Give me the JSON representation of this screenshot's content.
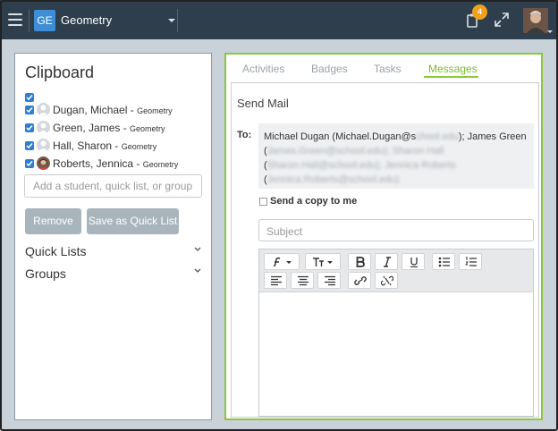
{
  "header": {
    "course_badge": "GE",
    "course_name": "Geometry",
    "notification_count": "4"
  },
  "clipboard": {
    "title": "Clipboard",
    "students": [
      {
        "name": "Dugan, Michael",
        "course": "Geometry"
      },
      {
        "name": "Green, James",
        "course": "Geometry"
      },
      {
        "name": "Hall, Sharon",
        "course": "Geometry"
      },
      {
        "name": "Roberts, Jennica",
        "course": "Geometry"
      }
    ],
    "separator": " - ",
    "add_placeholder": "Add a student, quick list, or group",
    "remove_label": "Remove",
    "save_label": "Save as Quick List",
    "quick_lists_label": "Quick Lists",
    "groups_label": "Groups"
  },
  "tabs": {
    "activities": "Activities",
    "badges": "Badges",
    "tasks": "Tasks",
    "messages": "Messages"
  },
  "mail": {
    "title": "Send Mail",
    "to_label": "To:",
    "to_line1_a": "Michael Dugan (Michael.Dugan@s",
    "to_line1_blur": "chool.edu",
    "to_line1_b": "); James Green",
    "to_line2_a": "(",
    "to_line2_blur": "James.Green@school.edu); Sharon Hall",
    "to_line3_a": "(",
    "to_line3_blur": "Sharon.Hall@school.edu); Jennica Roberts",
    "to_line4_a": "(",
    "to_line4_blur": "Jennica.Roberts@school.edu)",
    "copy_label": "Send a copy to me",
    "subject_placeholder": "Subject"
  },
  "colors": {
    "topbar": "#2f3e4c",
    "accent_green": "#8cc63f",
    "checkbox_blue": "#2d7fd3",
    "badge_orange": "#f0a01e"
  }
}
